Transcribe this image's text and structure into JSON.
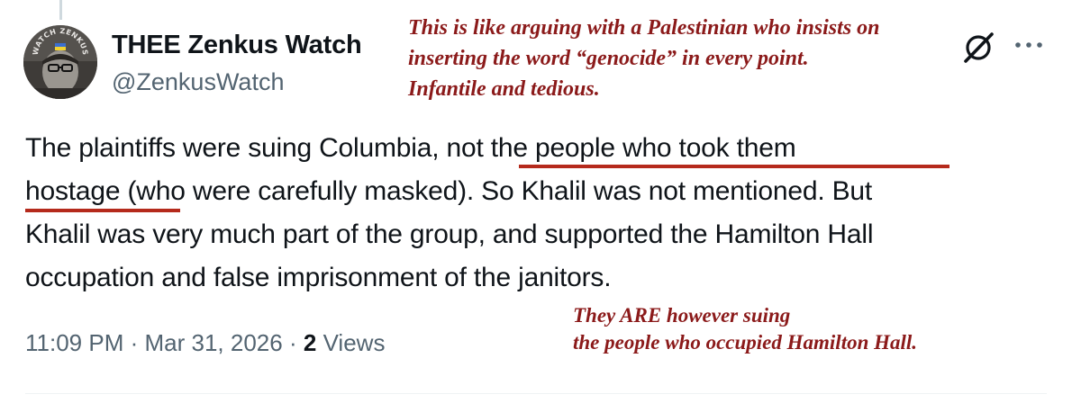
{
  "author": {
    "display_name": "THEE Zenkus Watch",
    "handle": "@ZenkusWatch",
    "avatar_badge_text": "WATCH ZENKUS"
  },
  "annotation_top": {
    "lines": [
      "This is like arguing with a Palestinian who insists on",
      "inserting the word “genocide” in every point.",
      "Infantile and tedious."
    ]
  },
  "tweet": {
    "lines": [
      "The plaintiffs were suing Columbia, not the people who took them",
      "hostage (who were carefully masked). So Khalil was not mentioned. But",
      "Khalil was very much part of the group, and supported the Hamilton Hall",
      "occupation and false imprisonment of the janitors."
    ]
  },
  "annotation_bottom": {
    "lines": [
      "They ARE however suing",
      "the people who occupied Hamilton Hall."
    ]
  },
  "meta": {
    "time": "11:09 PM",
    "separator": "·",
    "date": "Mar 31, 2026",
    "views_count": "2",
    "views_label": "Views"
  },
  "icons": {
    "grok": "grok-icon",
    "more": "more-icon"
  },
  "colors": {
    "annotation": "#8b1a1a",
    "underline": "#b52a1c",
    "secondary_text": "#536471"
  }
}
